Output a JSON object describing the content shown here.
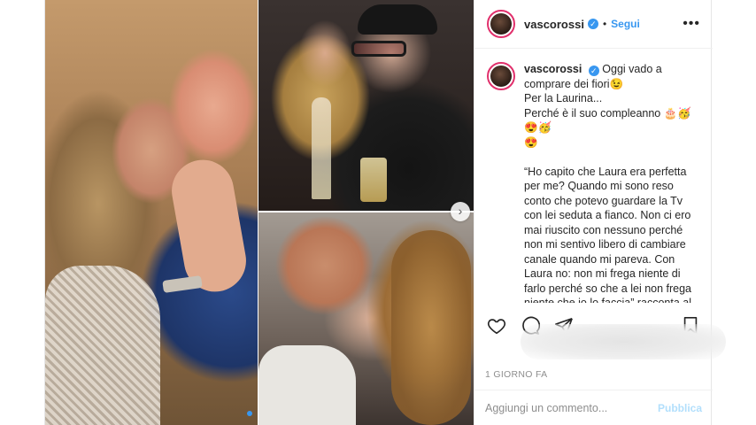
{
  "post": {
    "username": "vascorossi",
    "follow_label": "Segui",
    "separator": "•",
    "more_label": "•••",
    "verified_mark": "✓",
    "caption": "Oggi vado a comprare dei fiori😉\nPer la Laurina...\nPerché è il suo compleanno 🎂🥳😍🥳\n😍\n\n“Ho capito che Laura era perfetta per me? Quando mi sono reso conto che potevo guardare la Tv con lei seduta a fianco. Non ci ero mai riuscito con nessuno perché non mi sentivo libero di cambiare canale quando mi pareva. Con Laura no: non mi frega niente di farlo perché so che a lei non frega niente che io lo faccia” racconta al giornalista che lo ha incontrato nella sua casa di Zocca “Dal nostro amore è nato nel 1991 Luca. Lei lo voleva e io anche. Visto",
    "timestamp": "1 GIORNO FA",
    "comment_placeholder": "Aggiungi un commento...",
    "publish_label": "Pubblica",
    "carousel_arrow": "›"
  },
  "icons": {
    "like": "heart-icon",
    "comment": "comment-icon",
    "share": "share-icon",
    "save": "bookmark-icon"
  },
  "colors": {
    "accent": "#3897f0",
    "publish_disabled": "#b2dffc",
    "muted": "#8e8e8e",
    "text": "#262626"
  },
  "carousel": {
    "active_index": 0,
    "count": 1
  }
}
